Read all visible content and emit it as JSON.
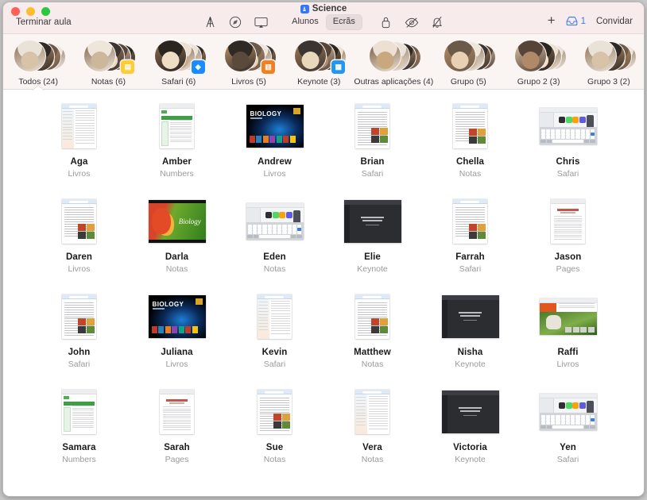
{
  "window": {
    "title": "Science",
    "app_icon": "classroom-app-icon",
    "traffic_lights": [
      "close",
      "minimize",
      "zoom"
    ]
  },
  "toolbar": {
    "end_class_label": "Terminar aula",
    "center_icons": [
      {
        "name": "airplay-classroom-icon",
        "glyph": "airplay"
      },
      {
        "name": "safari-navigate-icon",
        "glyph": "compass"
      },
      {
        "name": "screen-share-icon",
        "glyph": "monitor"
      }
    ],
    "segmented": {
      "options": [
        "Alunos",
        "Ecrãs"
      ],
      "selected": "Ecrãs"
    },
    "right_icons": [
      {
        "name": "lock-screen-icon",
        "glyph": "lock"
      },
      {
        "name": "hide-screen-icon",
        "glyph": "eye-slash"
      },
      {
        "name": "mute-icon",
        "glyph": "bell-slash"
      }
    ],
    "add_label": "+",
    "inbox_icon": "inbox-tray-icon",
    "inbox_count": "1",
    "invite_label": "Convidar",
    "accent_color": "#3478f6"
  },
  "groups": {
    "selected_index": 0,
    "items": [
      {
        "label": "Todos (24)",
        "app_badge": null,
        "badge_color": null
      },
      {
        "label": "Notas (6)",
        "app_badge": "notes-app-icon",
        "badge_color": "#ffcc33"
      },
      {
        "label": "Safari (6)",
        "app_badge": "safari-app-icon",
        "badge_color": "#1a8cff"
      },
      {
        "label": "Livros (5)",
        "app_badge": "books-app-icon",
        "badge_color": "#f08021"
      },
      {
        "label": "Keynote (3)",
        "app_badge": "keynote-app-icon",
        "badge_color": "#2196f3"
      },
      {
        "label": "Outras aplicações (4)",
        "app_badge": null,
        "badge_color": null
      },
      {
        "label": "Grupo (5)",
        "app_badge": null,
        "badge_color": null
      },
      {
        "label": "Grupo 2 (3)",
        "app_badge": null,
        "badge_color": null
      },
      {
        "label": "Grupo 3 (2)",
        "app_badge": null,
        "badge_color": null
      }
    ]
  },
  "students": [
    {
      "name": "Aga",
      "app": "Livros",
      "screen": "notes-doc"
    },
    {
      "name": "Amber",
      "app": "Numbers",
      "screen": "numbers-doc"
    },
    {
      "name": "Andrew",
      "app": "Livros",
      "screen": "biology-cover"
    },
    {
      "name": "Brian",
      "app": "Safari",
      "screen": "safari-article"
    },
    {
      "name": "Chella",
      "app": "Notas",
      "screen": "safari-article-photos"
    },
    {
      "name": "Chris",
      "app": "Safari",
      "screen": "ipad-home-keyboard"
    },
    {
      "name": "Daren",
      "app": "Livros",
      "screen": "safari-article-photos"
    },
    {
      "name": "Darla",
      "app": "Notas",
      "screen": "parrot-biology"
    },
    {
      "name": "Eden",
      "app": "Notas",
      "screen": "ipad-home-keyboard"
    },
    {
      "name": "Elie",
      "app": "Keynote",
      "screen": "keynote-dark"
    },
    {
      "name": "Farrah",
      "app": "Safari",
      "screen": "safari-article-photos"
    },
    {
      "name": "Jason",
      "app": "Pages",
      "screen": "pages-report"
    },
    {
      "name": "John",
      "app": "Safari",
      "screen": "safari-article"
    },
    {
      "name": "Juliana",
      "app": "Livros",
      "screen": "biology-cover"
    },
    {
      "name": "Kevin",
      "app": "Safari",
      "screen": "notes-doc"
    },
    {
      "name": "Matthew",
      "app": "Notas",
      "screen": "safari-article"
    },
    {
      "name": "Nisha",
      "app": "Keynote",
      "screen": "keynote-dark"
    },
    {
      "name": "Raffi",
      "app": "Livros",
      "screen": "raffi-book"
    },
    {
      "name": "Samara",
      "app": "Numbers",
      "screen": "numbers-doc"
    },
    {
      "name": "Sarah",
      "app": "Pages",
      "screen": "pages-report"
    },
    {
      "name": "Sue",
      "app": "Notas",
      "screen": "safari-article"
    },
    {
      "name": "Vera",
      "app": "Notas",
      "screen": "notes-doc"
    },
    {
      "name": "Victoria",
      "app": "Keynote",
      "screen": "keynote-dark"
    },
    {
      "name": "Yen",
      "app": "Safari",
      "screen": "ipad-home-keyboard"
    }
  ]
}
